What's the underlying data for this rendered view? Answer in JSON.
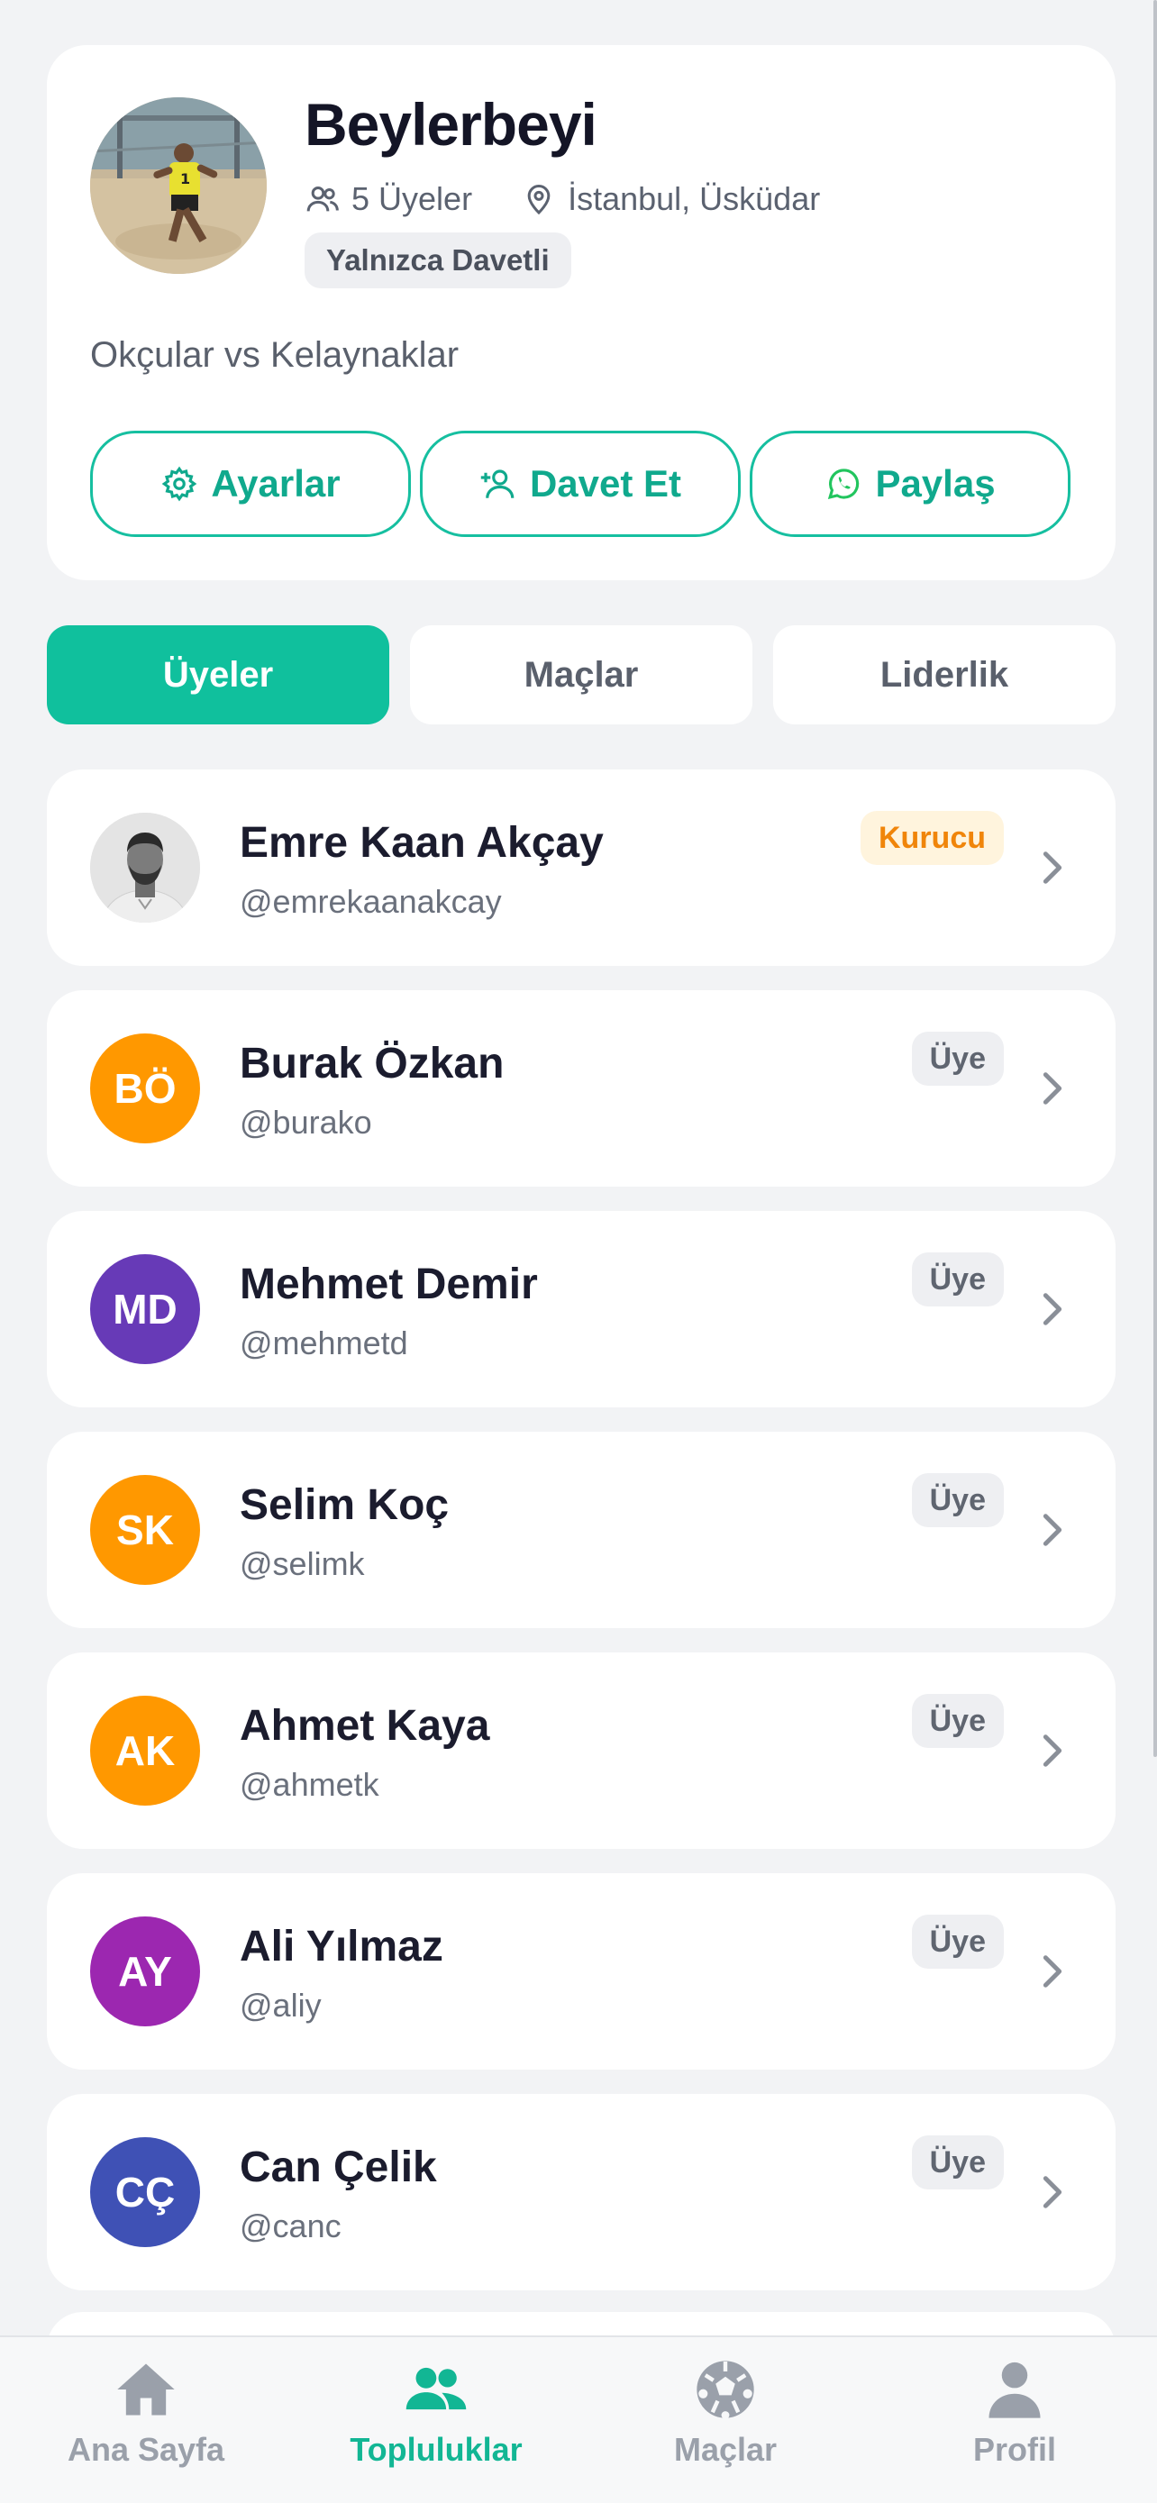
{
  "community": {
    "name": "Beylerbeyi",
    "members_count": "5 Üyeler",
    "location": "İstanbul, Üsküdar",
    "access": "Yalnızca Davetli",
    "description": "Okçular vs Kelaynaklar"
  },
  "actions": {
    "settings": "Ayarlar",
    "invite": "Davet Et",
    "share": "Paylaş"
  },
  "tabs": [
    "Üyeler",
    "Maçlar",
    "Liderlik"
  ],
  "members": [
    {
      "name": "Emre Kaan Akçay",
      "handle": "@emrekaanakcay",
      "role": "Kurucu",
      "initials": "",
      "color": "#555"
    },
    {
      "name": "Burak Özkan",
      "handle": "@burako",
      "role": "Üye",
      "initials": "BÖ",
      "color": "#ff9800"
    },
    {
      "name": "Mehmet Demir",
      "handle": "@mehmetd",
      "role": "Üye",
      "initials": "MD",
      "color": "#673ab7"
    },
    {
      "name": "Selim Koç",
      "handle": "@selimk",
      "role": "Üye",
      "initials": "SK",
      "color": "#ff9800"
    },
    {
      "name": "Ahmet Kaya",
      "handle": "@ahmetk",
      "role": "Üye",
      "initials": "AK",
      "color": "#ff9800"
    },
    {
      "name": "Ali Yılmaz",
      "handle": "@aliy",
      "role": "Üye",
      "initials": "AY",
      "color": "#9c27b0"
    },
    {
      "name": "Can Çelik",
      "handle": "@canc",
      "role": "Üye",
      "initials": "CÇ",
      "color": "#3f51b5"
    }
  ],
  "nav": [
    "Ana Sayfa",
    "Topluluklar",
    "Maçlar",
    "Profil"
  ],
  "colors": {
    "accent": "#10c09d",
    "founder_badge": "#f0850a"
  }
}
